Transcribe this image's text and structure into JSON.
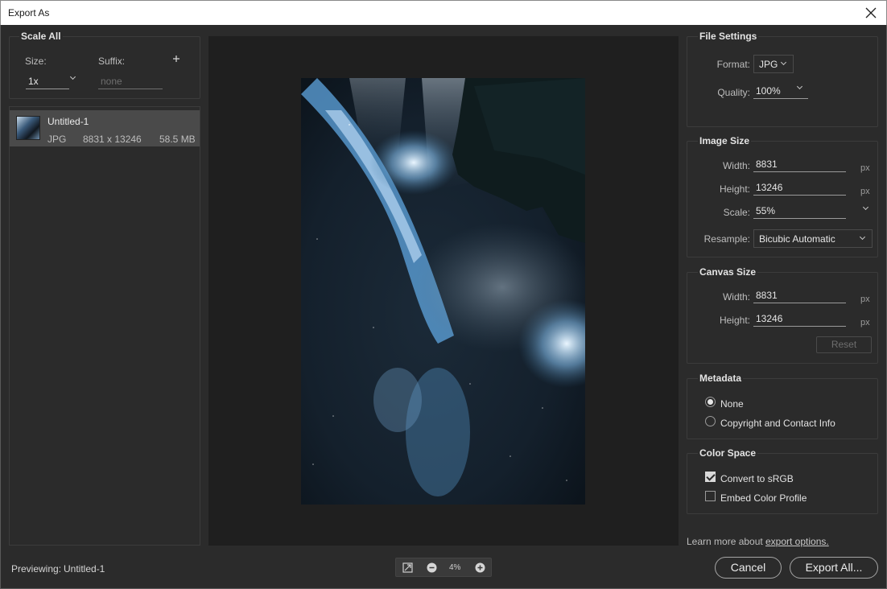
{
  "window": {
    "title": "Export As"
  },
  "left": {
    "section_title": "Scale All",
    "size_label": "Size:",
    "suffix_label": "Suffix:",
    "size_value": "1x",
    "suffix_placeholder": "none",
    "asset": {
      "name": "Untitled-1",
      "format": "JPG",
      "dimensions": "8831 x 13246",
      "filesize": "58.5 MB"
    }
  },
  "file_settings": {
    "title": "File Settings",
    "format_label": "Format:",
    "format_value": "JPG",
    "quality_label": "Quality:",
    "quality_value": "100%"
  },
  "image_size": {
    "title": "Image Size",
    "width_label": "Width:",
    "width_value": "8831",
    "height_label": "Height:",
    "height_value": "13246",
    "scale_label": "Scale:",
    "scale_value": "55%",
    "resample_label": "Resample:",
    "resample_value": "Bicubic Automatic",
    "unit": "px"
  },
  "canvas_size": {
    "title": "Canvas Size",
    "width_label": "Width:",
    "width_value": "8831",
    "height_label": "Height:",
    "height_value": "13246",
    "unit": "px",
    "reset_label": "Reset"
  },
  "metadata": {
    "title": "Metadata",
    "options": [
      "None",
      "Copyright and Contact Info"
    ],
    "selected": "None"
  },
  "color_space": {
    "title": "Color Space",
    "convert_label": "Convert to sRGB",
    "convert_checked": true,
    "embed_label": "Embed Color Profile",
    "embed_checked": false
  },
  "footer": {
    "previewing_label": "Previewing:",
    "previewing_name": "Untitled-1",
    "zoom_value": "4%",
    "learn_more_text": "Learn more about",
    "learn_more_link": "export options.",
    "cancel_label": "Cancel",
    "export_label": "Export All..."
  },
  "icons": {
    "close": "close-icon",
    "add": "plus-icon",
    "zoom_fit": "fit-screen-icon",
    "zoom_out": "zoom-out-icon",
    "zoom_in": "zoom-in-icon"
  }
}
